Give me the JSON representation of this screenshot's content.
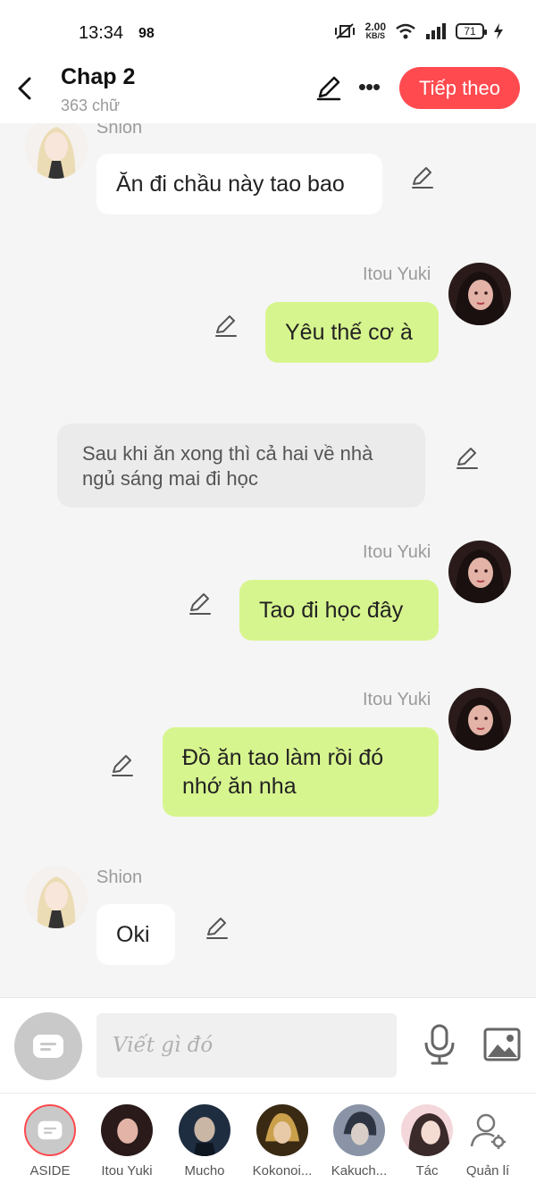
{
  "status_bar": {
    "time": "13:34",
    "badge": "98",
    "speed_value": "2.00",
    "speed_unit": "KB/S",
    "battery": "71"
  },
  "header": {
    "title": "Chap 2",
    "subtitle": "363 chữ",
    "next_label": "Tiếp theo"
  },
  "messages": [
    {
      "type": "left",
      "speaker": "Shion",
      "text": "Ăn đi chầu này tao bao"
    },
    {
      "type": "right",
      "speaker": "Itou Yuki",
      "text": "Yêu thế cơ à"
    },
    {
      "type": "narration",
      "text": "Sau khi ăn xong thì cả hai về nhà ngủ sáng mai đi học"
    },
    {
      "type": "right",
      "speaker": "Itou Yuki",
      "text": "Tao đi học đây"
    },
    {
      "type": "right",
      "speaker": "Itou Yuki",
      "text": "Đồ ăn tao làm rồi đó nhớ ăn nha"
    },
    {
      "type": "left",
      "speaker": "Shion",
      "text": "Oki"
    }
  ],
  "input": {
    "placeholder": "Viết gì đó"
  },
  "characters": [
    {
      "label": "ASIDE"
    },
    {
      "label": "Itou Yuki"
    },
    {
      "label": "Mucho"
    },
    {
      "label": "Kokonoi..."
    },
    {
      "label": "Kakuch..."
    },
    {
      "label": "Tác"
    },
    {
      "label": "Quản lí"
    }
  ],
  "colors": {
    "accent": "#ff4a4f",
    "right_bubble": "#d7f58e",
    "background": "#f5f5f5"
  }
}
